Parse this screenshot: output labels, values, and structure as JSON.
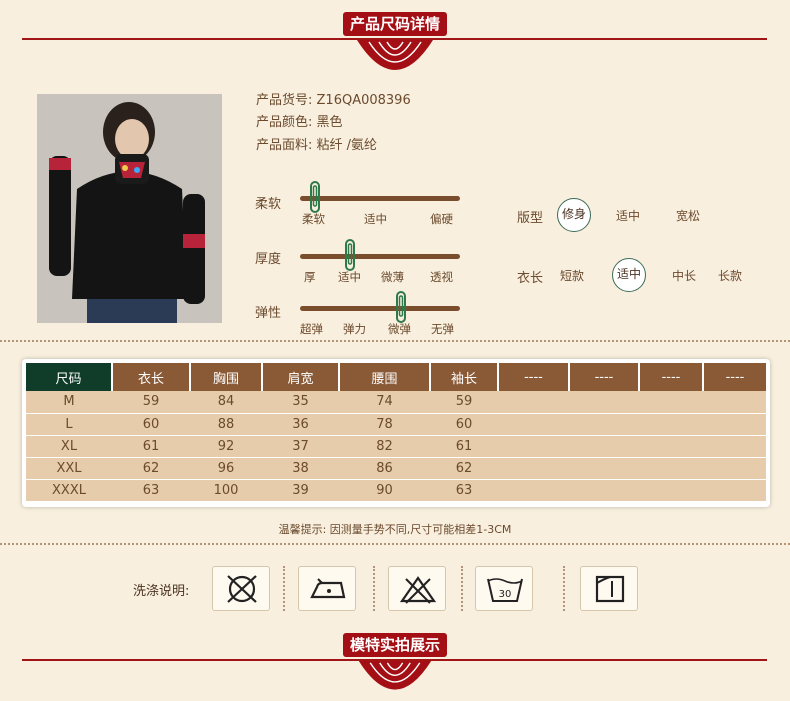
{
  "header": {
    "title": "产品尺码详情"
  },
  "footer": {
    "title": "模特实拍展示"
  },
  "product": {
    "code": "产品货号: Z16QA008396",
    "color": "产品颜色: 黑色",
    "fabric": "产品面料: 粘纤 /氨纶"
  },
  "sliders": [
    {
      "label": "柔软",
      "ticks": [
        "柔软",
        "适中",
        "偏硬"
      ],
      "selected_index": 0
    },
    {
      "label": "厚度",
      "ticks": [
        "厚",
        "适中",
        "微薄",
        "透视"
      ],
      "selected_index": 1
    },
    {
      "label": "弹性",
      "ticks": [
        "超弹",
        "弹力",
        "微弹",
        "无弹"
      ],
      "selected_index": 2
    }
  ],
  "fit": {
    "label": "版型",
    "options": [
      "修身",
      "适中",
      "宽松"
    ],
    "selected": "修身"
  },
  "length": {
    "label": "衣长",
    "options": [
      "短款",
      "适中",
      "中长",
      "长款"
    ],
    "selected": "适中"
  },
  "size_table": {
    "headers": [
      "尺码",
      "衣长",
      "胸围",
      "肩宽",
      "腰围",
      "袖长",
      "----",
      "----",
      "----",
      "----"
    ],
    "rows": [
      [
        "M",
        "59",
        "84",
        "35",
        "74",
        "59"
      ],
      [
        "L",
        "60",
        "88",
        "36",
        "78",
        "60"
      ],
      [
        "XL",
        "61",
        "92",
        "37",
        "82",
        "61"
      ],
      [
        "XXL",
        "62",
        "96",
        "38",
        "86",
        "62"
      ],
      [
        "XXXL",
        "63",
        "100",
        "39",
        "90",
        "63"
      ]
    ]
  },
  "tip": "温馨提示:   因测量手势不同,尺寸可能相差1-3CM",
  "washing": {
    "label": "洗涤说明:",
    "icons": [
      "no-dry-clean-icon",
      "low-iron-icon",
      "no-bleach-icon",
      "wash-30-icon",
      "hang-dry-icon"
    ],
    "wash_temp": "30"
  },
  "colors": {
    "accent_red": "#a30f14",
    "brown": "#8a5a36",
    "dark_green": "#0f3d2a",
    "cell": "#e6ccaa"
  }
}
